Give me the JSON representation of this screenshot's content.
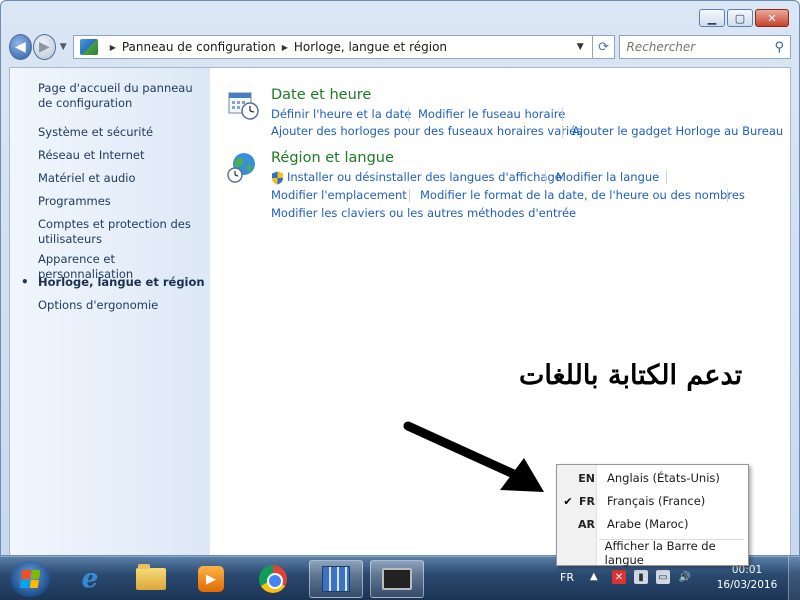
{
  "window": {
    "caption": {
      "minimize": "▁",
      "maximize": "▢",
      "close": "✕"
    }
  },
  "address_bar": {
    "crumbs": [
      "Panneau de configuration",
      "Horloge, langue et région"
    ],
    "search_placeholder": "Rechercher"
  },
  "sidebar": {
    "items": [
      {
        "label": "Page d'accueil du panneau de configuration"
      },
      {
        "label": "Système et sécurité"
      },
      {
        "label": "Réseau et Internet"
      },
      {
        "label": "Matériel et audio"
      },
      {
        "label": "Programmes"
      },
      {
        "label": "Comptes et protection des utilisateurs"
      },
      {
        "label": "Apparence et personnalisation"
      },
      {
        "label": "Horloge, langue et région"
      },
      {
        "label": "Options d'ergonomie"
      }
    ],
    "current_bullet": "•"
  },
  "sections": {
    "date": {
      "title": "Date et heure",
      "links": [
        "Définir l'heure et la date",
        "Modifier le fuseau horaire",
        "Ajouter des horloges pour des fuseaux horaires variés",
        "Ajouter le gadget Horloge au Bureau"
      ]
    },
    "region": {
      "title": "Région et langue",
      "links": [
        "Installer ou désinstaller des langues d'affichage",
        "Modifier la langue",
        "Modifier l'emplacement",
        "Modifier le format de la date, de l'heure ou des nombres",
        "Modifier les claviers ou les autres méthodes d'entrée"
      ]
    }
  },
  "annotation": {
    "arabic_text": "تدعم الكتابة باللغات",
    "arrow_color": "#000000"
  },
  "language_menu": {
    "items": [
      {
        "code": "EN",
        "name": "Anglais (États-Unis)",
        "checked": false
      },
      {
        "code": "FR",
        "name": "Français (France)",
        "checked": true
      },
      {
        "code": "AR",
        "name": "Arabe (Maroc)",
        "checked": false
      }
    ],
    "check_mark": "✔",
    "show_bar_label": "Afficher la Barre de langue"
  },
  "taskbar": {
    "apps": [
      "internet-explorer",
      "windows-explorer",
      "media-player",
      "chrome",
      "network-app",
      "screen-app"
    ],
    "tray": {
      "language": "FR",
      "time": "00:01",
      "date": "16/03/2016"
    }
  },
  "colors": {
    "link": "#1f5fbd",
    "section_title": "#1e7a24",
    "sidebar_text": "#1e395b"
  }
}
